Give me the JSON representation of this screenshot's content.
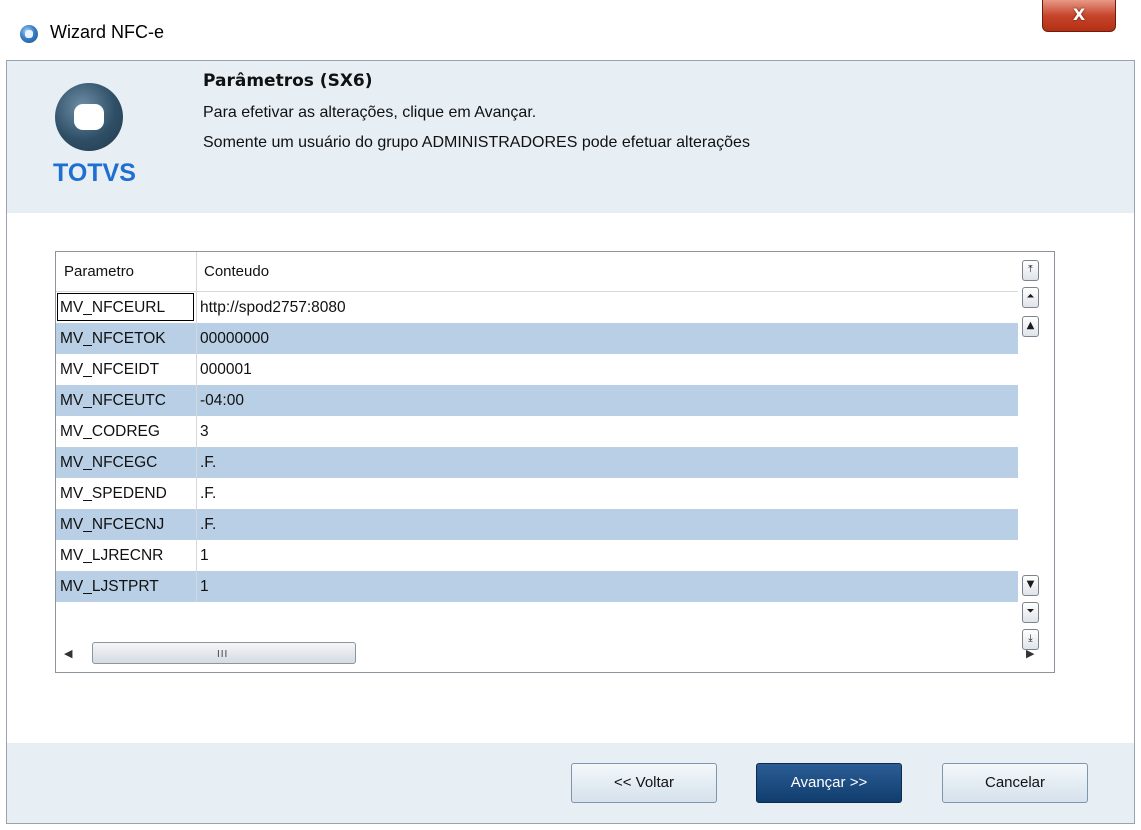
{
  "window": {
    "title": "Wizard NFC-e",
    "close_glyph": "X"
  },
  "header": {
    "logo_text": "TOTVS",
    "title": "Parâmetros (SX6)",
    "line1": "Para efetivar as alterações, clique em Avançar.",
    "line2": "Somente um usuário do grupo ADMINISTRADORES pode efetuar alterações"
  },
  "grid": {
    "columns": [
      "Parametro",
      "Conteudo"
    ],
    "rows": [
      {
        "parametro": "MV_NFCEURL",
        "conteudo": "http://spod2757:8080"
      },
      {
        "parametro": "MV_NFCETOK",
        "conteudo": "00000000"
      },
      {
        "parametro": "MV_NFCEIDT",
        "conteudo": "000001"
      },
      {
        "parametro": "MV_NFCEUTC",
        "conteudo": "-04:00"
      },
      {
        "parametro": "MV_CODREG",
        "conteudo": "3"
      },
      {
        "parametro": "MV_NFCEGC",
        "conteudo": ".F."
      },
      {
        "parametro": "MV_SPEDEND",
        "conteudo": ".F."
      },
      {
        "parametro": "MV_NFCECNJ",
        "conteudo": ".F."
      },
      {
        "parametro": "MV_LJRECNR",
        "conteudo": "1"
      },
      {
        "parametro": "MV_LJSTPRT",
        "conteudo": "1"
      }
    ],
    "scroll_grip": "III"
  },
  "buttons": {
    "back": "<< Voltar",
    "next": "Avançar >>",
    "cancel": "Cancelar"
  },
  "colors": {
    "header_bg": "#e7eef4",
    "row_alt": "#b8cfe6",
    "primary_button": "#1a4a80",
    "logo_blue": "#1e6fd0"
  }
}
